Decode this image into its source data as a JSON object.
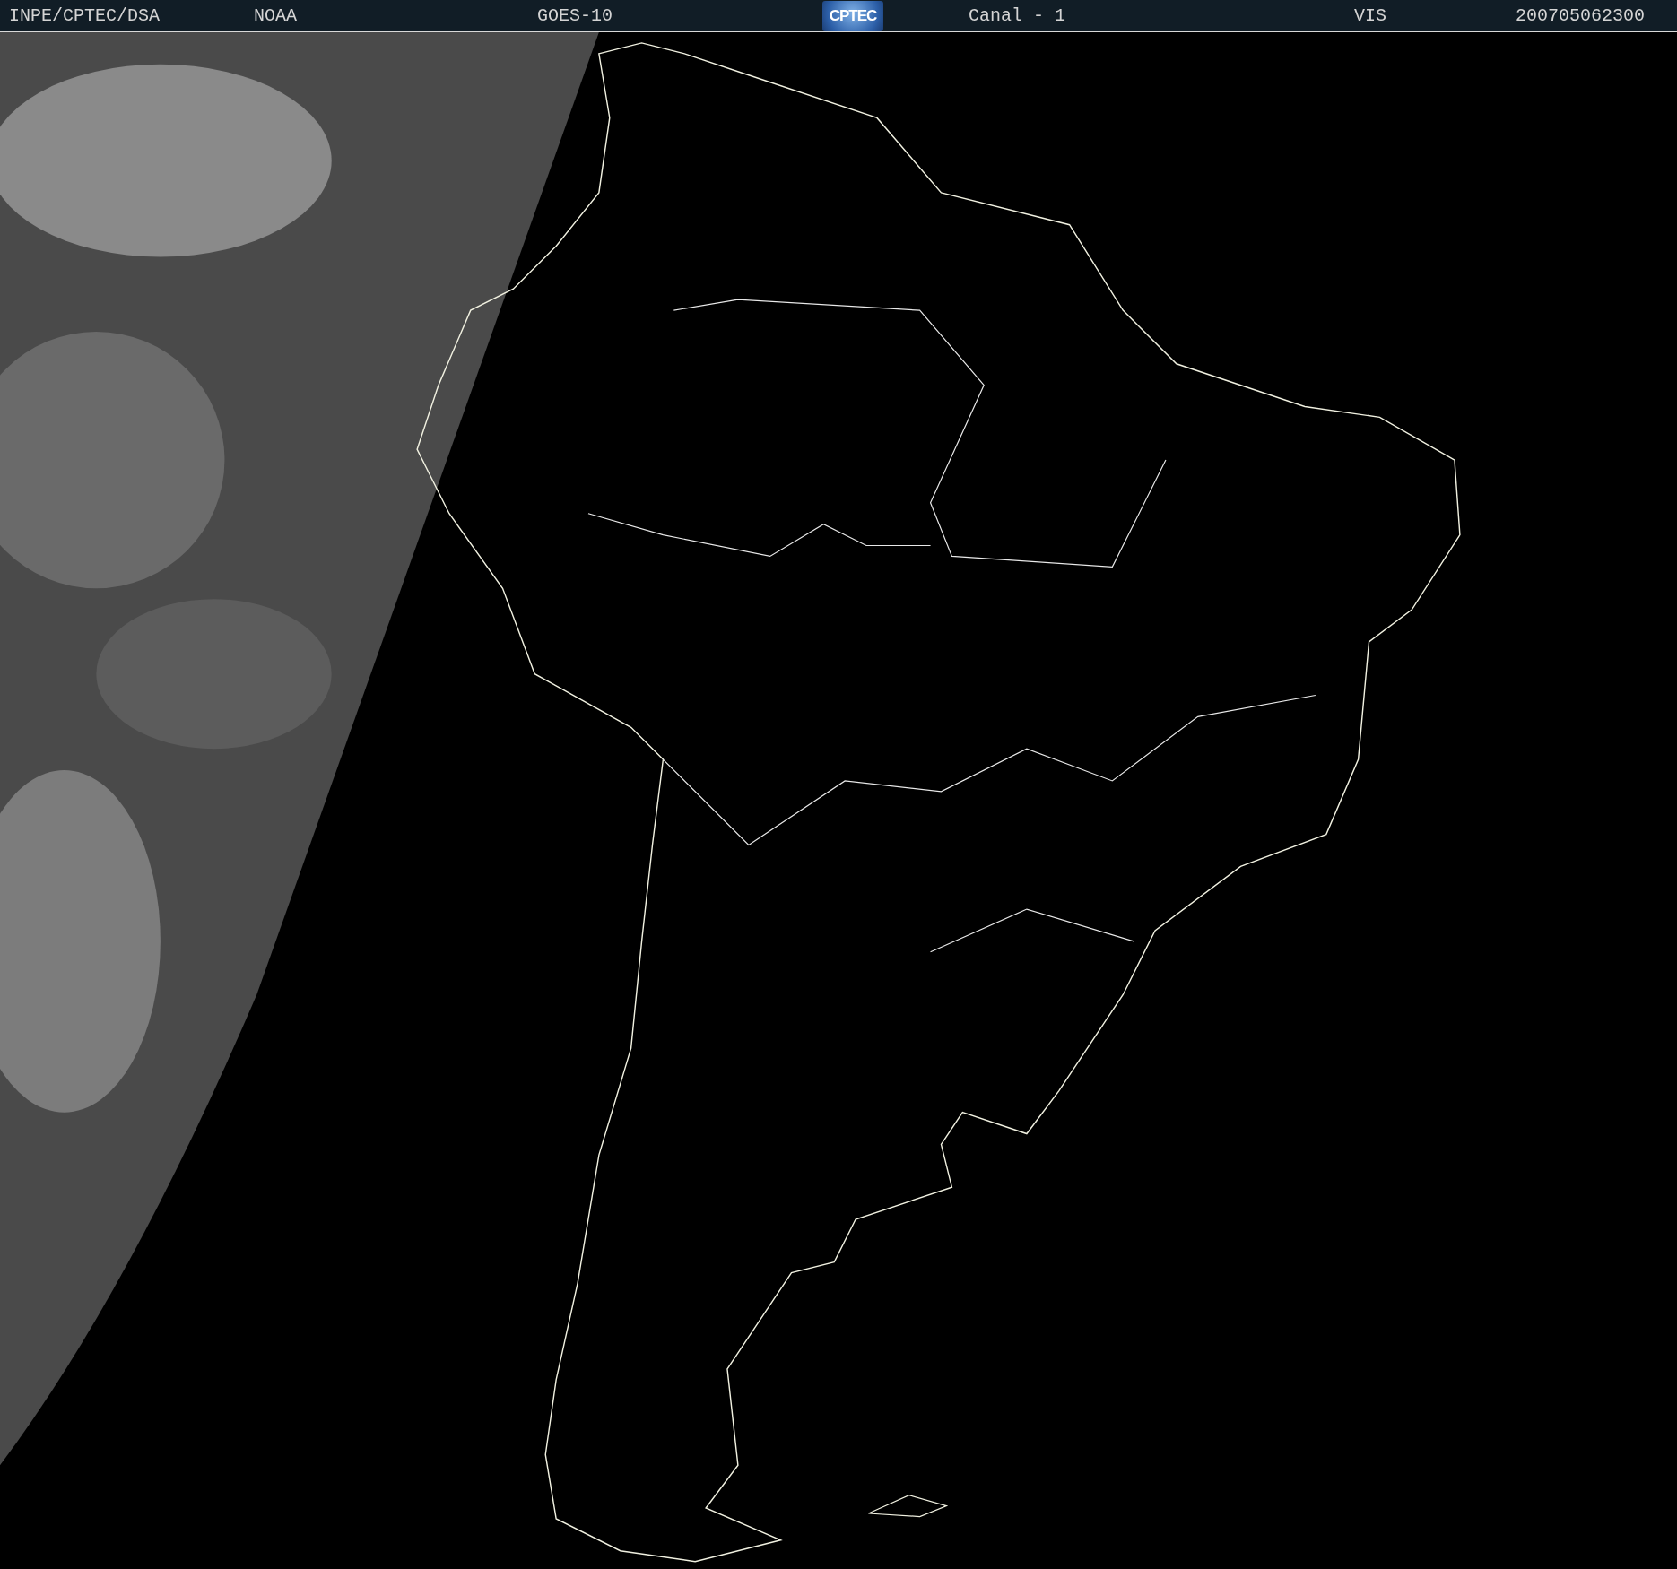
{
  "header": {
    "source": "INPE/CPTEC/DSA",
    "agency": "NOAA",
    "satellite": "GOES-10",
    "logo": "CPTEC",
    "channel": "Canal - 1",
    "band": "VIS",
    "timestamp": "200705062300"
  }
}
